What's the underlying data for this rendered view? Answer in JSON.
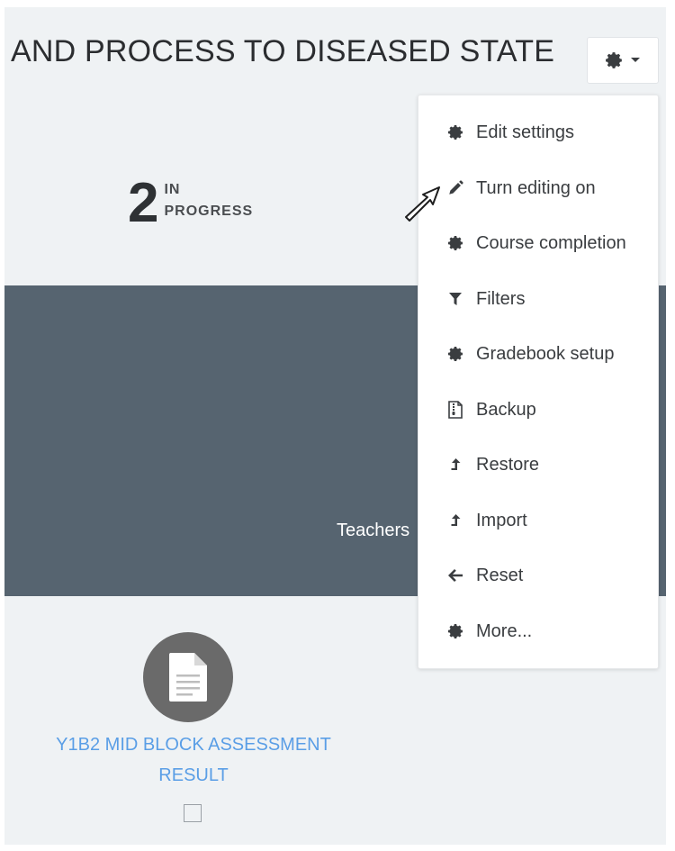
{
  "header": {
    "course_title": "AND PROCESS TO DISEASED STATE",
    "actions_icon": "gear-icon",
    "caret_icon": "caret-down-icon"
  },
  "progress": {
    "count": "2",
    "label_line1": "IN",
    "label_line2": "PROGRESS"
  },
  "banner": {
    "text": "Teachers"
  },
  "activity": {
    "icon": "document-icon",
    "title_line1": "Y1B2 MID BLOCK ASSESSMENT",
    "title_line2": "RESULT"
  },
  "menu": {
    "items": [
      {
        "label": "Edit settings",
        "icon": "gear-icon"
      },
      {
        "label": "Turn editing on",
        "icon": "pencil-icon"
      },
      {
        "label": "Course completion",
        "icon": "gear-icon"
      },
      {
        "label": "Filters",
        "icon": "filter-icon"
      },
      {
        "label": "Gradebook setup",
        "icon": "gear-icon"
      },
      {
        "label": "Backup",
        "icon": "file-archive-icon"
      },
      {
        "label": "Restore",
        "icon": "upload-icon"
      },
      {
        "label": "Import",
        "icon": "upload-icon"
      },
      {
        "label": "Reset",
        "icon": "arrow-left-icon"
      },
      {
        "label": "More...",
        "icon": "gear-icon"
      }
    ]
  },
  "colors": {
    "page_bg": "#eff2f4",
    "banner_bg": "#566470",
    "link": "#5a9ee6",
    "text_dark": "#2b2d30"
  }
}
